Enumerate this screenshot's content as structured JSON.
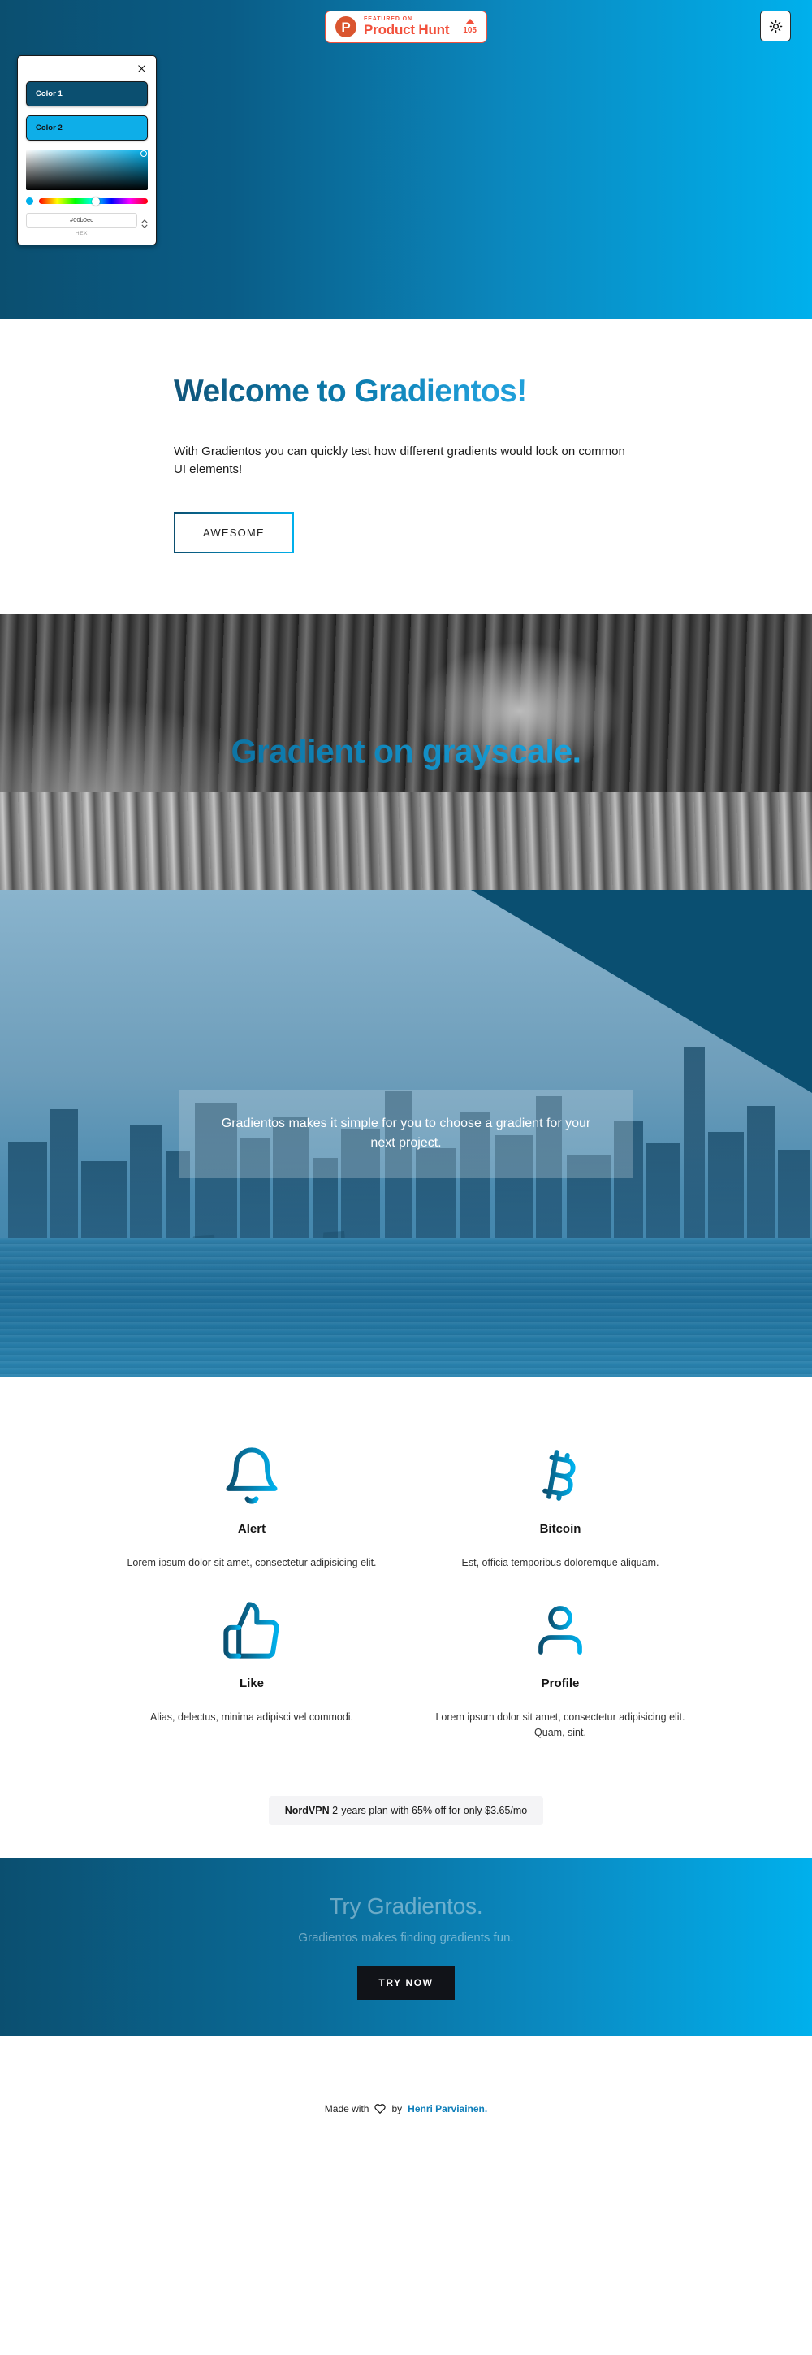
{
  "theme": {
    "gradient_start": "#0b4f70",
    "gradient_end": "#00b0ec",
    "accent": "#00b0ec"
  },
  "hero": {
    "product_hunt": {
      "logo_letter": "P",
      "featured_label": "FEATURED ON",
      "name": "Product Hunt",
      "upvotes": "105"
    },
    "theme_toggle_icon": "sun-icon"
  },
  "color_picker": {
    "close_icon": "close-icon",
    "color1_label": "Color 1",
    "color2_label": "Color 2",
    "hex_value": "#00b0ec",
    "hex_label": "HEX",
    "spinner_icon": "stepper-icon"
  },
  "welcome": {
    "heading": "Welcome to Gradientos!",
    "paragraph": "With Gradientos you can quickly test how different gradients would look on common UI elements!",
    "button_label": "AWESOME"
  },
  "grayscale_section": {
    "title": "Gradient on grayscale."
  },
  "city_section": {
    "overlay_text": "Gradientos makes it simple for you to choose a gradient for your next project."
  },
  "features": [
    {
      "icon": "bell-icon",
      "title": "Alert",
      "description": "Lorem ipsum dolor sit amet, consectetur adipisicing elit."
    },
    {
      "icon": "bitcoin-icon",
      "title": "Bitcoin",
      "description": "Est, officia temporibus doloremque aliquam."
    },
    {
      "icon": "thumbs-up-icon",
      "title": "Like",
      "description": "Alias, delectus, minima adipisci vel commodi."
    },
    {
      "icon": "profile-icon",
      "title": "Profile",
      "description": "Lorem ipsum dolor sit amet, consectetur adipisicing elit. Quam, sint."
    }
  ],
  "promo": {
    "brand": "NordVPN",
    "text": " 2-years plan with 65% off for only $3.65/mo"
  },
  "cta": {
    "heading": "Try Gradientos.",
    "subheading": "Gradientos makes finding gradients fun.",
    "button_label": "TRY NOW"
  },
  "footer": {
    "made_with": "Made with",
    "heart_icon": "heart-icon",
    "by": "by",
    "author": "Henri Parviainen."
  }
}
